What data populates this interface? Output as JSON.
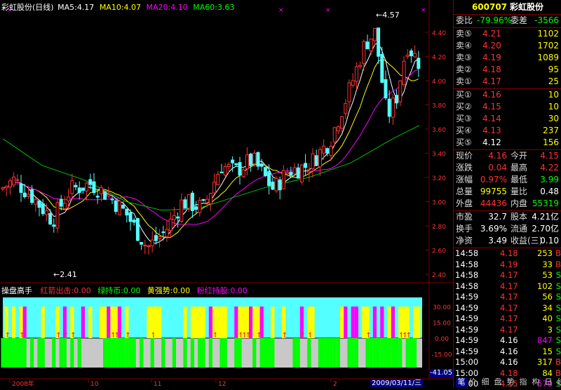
{
  "chart_header": {
    "title": "彩虹股份(日线)",
    "ma5": "MA5:4.17",
    "ma10": "MA10:4.07",
    "ma20": "MA20:4.10",
    "ma60": "MA60:3.63"
  },
  "price_axis": [
    "4.40",
    "4.20",
    "4.00",
    "3.80",
    "3.60",
    "3.40",
    "3.20",
    "3.00",
    "2.80",
    "2.60",
    "2.40"
  ],
  "price_annotations": {
    "high": "4.57",
    "low": "2.41"
  },
  "indicator_header": {
    "name": "操盘高手",
    "s1": "红箭出击:0.00",
    "s2": "绿持币:0.00",
    "s3": "黄强势:0.00",
    "s4": "粉红持股:0.00"
  },
  "indicator_axis": [
    "30.00",
    "15.00",
    "0.00",
    "-15.00"
  ],
  "indicator_readout": "-41.05",
  "date_axis": [
    "2008年",
    "10",
    "11",
    "12",
    "2"
  ],
  "cursor_date": "2009/03/11/三",
  "colors": {
    "up": "#ff3232",
    "down": "#54ffff",
    "ma5": "#ffffff",
    "ma10": "#ffff00",
    "ma20": "#ff00ff",
    "ma60": "#00c000",
    "cyan": "#54ffff",
    "magenta": "#ff00ff",
    "yellow": "#ffff00",
    "green": "#00ff00",
    "gray": "#c8c8c8"
  },
  "quote": {
    "code": "600707",
    "name": "彩虹股份",
    "weibi_label": "委比",
    "weibi": "-79.96%",
    "weicha_label": "委差",
    "weicha": "-3566",
    "asks": [
      {
        "label": "卖⑤",
        "price": "4.21",
        "vol": "1102"
      },
      {
        "label": "卖④",
        "price": "4.20",
        "vol": "1702"
      },
      {
        "label": "卖③",
        "price": "4.19",
        "vol": "1089"
      },
      {
        "label": "卖②",
        "price": "4.18",
        "vol": "95"
      },
      {
        "label": "卖①",
        "price": "4.17",
        "vol": "25"
      }
    ],
    "bids": [
      {
        "label": "买①",
        "price": "4.16",
        "vol": "10"
      },
      {
        "label": "买②",
        "price": "4.15",
        "vol": "10"
      },
      {
        "label": "买③",
        "price": "4.14",
        "vol": "30"
      },
      {
        "label": "买④",
        "price": "4.13",
        "vol": "237"
      },
      {
        "label": "买⑤",
        "price": "4.12",
        "vol": "156"
      }
    ],
    "stats": [
      {
        "l1": "现价",
        "v1": "4.16",
        "l2": "今开",
        "v2": "4.15"
      },
      {
        "l1": "涨跌",
        "v1": "0.04",
        "l2": "最高",
        "v2": "4.22"
      },
      {
        "l1": "涨幅",
        "v1": "0.97%",
        "l2": "最低",
        "v2": "3.99"
      },
      {
        "l1": "总量",
        "v1": "99755",
        "l2": "量比",
        "v2": "0.48"
      },
      {
        "l1": "外盘",
        "v1": "44436",
        "l2": "内盘",
        "v2": "55319"
      }
    ],
    "fund": [
      {
        "l1": "市盈",
        "v1": "32.7",
        "l2": "股本",
        "v2": "4.21亿"
      },
      {
        "l1": "换手",
        "v1": "3.69%",
        "l2": "流通",
        "v2": "2.70亿"
      },
      {
        "l1": "净资",
        "v1": "3.49",
        "l2": "收益(三)",
        "v2": "0.10"
      }
    ]
  },
  "ticks": [
    {
      "t": "14:58",
      "p": "4.18",
      "v": "253",
      "d": "B"
    },
    {
      "t": "14:58",
      "p": "4.19",
      "v": "33",
      "d": "B"
    },
    {
      "t": "14:58",
      "p": "4.17",
      "v": "53",
      "d": "S"
    },
    {
      "t": "14:58",
      "p": "4.17",
      "v": "102",
      "d": "S"
    },
    {
      "t": "14:59",
      "p": "4.17",
      "v": "56",
      "d": "S"
    },
    {
      "t": "14:59",
      "p": "4.17",
      "v": "34",
      "d": "S"
    },
    {
      "t": "14:59",
      "p": "4.17",
      "v": "40",
      "d": "S"
    },
    {
      "t": "14:59",
      "p": "4.17",
      "v": "3",
      "d": "S"
    },
    {
      "t": "14:59",
      "p": "4.16",
      "v": "847",
      "d": "S"
    },
    {
      "t": "14:59",
      "p": "4.16",
      "v": "15",
      "d": "S"
    },
    {
      "t": "15:00",
      "p": "4.16",
      "v": "317",
      "d": "B"
    },
    {
      "t": "15:00",
      "p": "4.18",
      "v": "84",
      "d": "B"
    },
    {
      "t": "15:00",
      "p": "4.15",
      "v": "570",
      "d": "S"
    }
  ],
  "bottom_tabs": [
    "笔",
    "价",
    "细",
    "盘",
    "势",
    "指",
    "构",
    "日",
    "线"
  ]
}
